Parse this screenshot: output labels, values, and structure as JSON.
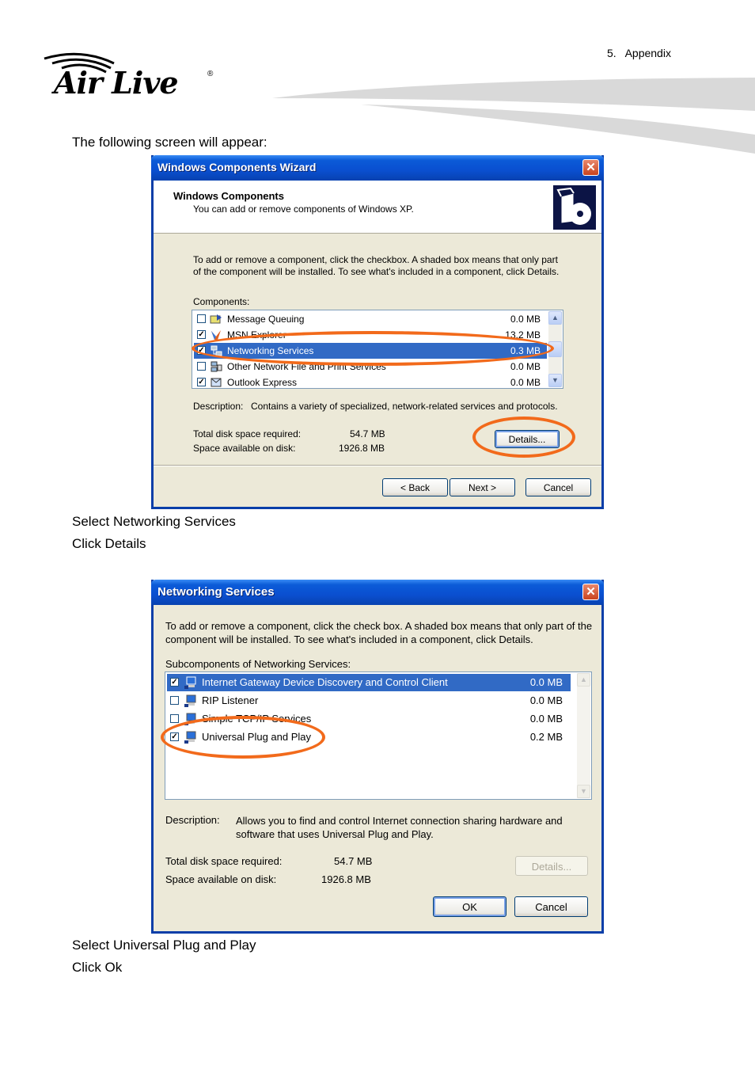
{
  "header": {
    "logo_text": "Air Live",
    "logo_registered": "®",
    "section": "5.   Appendix"
  },
  "instructions": {
    "intro": "The following screen will appear:",
    "step1_a": "Select Networking Services",
    "step1_b": "Click Details",
    "step2_a": "Select Universal Plug and Play",
    "step2_b": "Click Ok"
  },
  "wizard": {
    "title": "Windows Components Wizard",
    "close": "✕",
    "heading": "Windows Components",
    "subheading": "You can add or remove components of Windows XP.",
    "instruction": "To add or remove a component, click the checkbox.  A shaded box means that only part of the component will be installed.  To see what's included in a component, click Details.",
    "components_label": "Components:",
    "components": [
      {
        "name": "Message Queuing",
        "size": "0.0 MB",
        "checked": false,
        "selected": false,
        "icon": "message-queue-icon"
      },
      {
        "name": "MSN Explorer",
        "size": "13.2 MB",
        "checked": true,
        "selected": false,
        "icon": "msn-butterfly-icon"
      },
      {
        "name": "Networking Services",
        "size": "0.3 MB",
        "checked": true,
        "selected": true,
        "icon": "network-icon"
      },
      {
        "name": "Other Network File and Print Services",
        "size": "0.0 MB",
        "checked": false,
        "selected": false,
        "icon": "network-printer-icon"
      },
      {
        "name": "Outlook Express",
        "size": "0.0 MB",
        "checked": true,
        "selected": false,
        "icon": "outlook-icon"
      }
    ],
    "description_label": "Description:",
    "description": "Contains a variety of specialized, network-related services and protocols.",
    "total_label": "Total disk space required:",
    "total_value": "54.7 MB",
    "avail_label": "Space available on disk:",
    "avail_value": "1926.8 MB",
    "details_button": "Details...",
    "back_button": "< Back",
    "next_button": "Next >",
    "cancel_button": "Cancel"
  },
  "netsvc": {
    "title": "Networking Services",
    "close": "✕",
    "instruction": "To add or remove a component, click the check box. A shaded box means that only part of the component will be installed. To see what's included in a component, click Details.",
    "subcomponents_label": "Subcomponents of Networking Services:",
    "items": [
      {
        "name": "Internet Gateway Device Discovery and Control Client",
        "size": "0.0 MB",
        "checked": true,
        "selected": true
      },
      {
        "name": "RIP Listener",
        "size": "0.0 MB",
        "checked": false,
        "selected": false
      },
      {
        "name": "Simple TCP/IP Services",
        "size": "0.0 MB",
        "checked": false,
        "selected": false
      },
      {
        "name": "Universal Plug and Play",
        "size": "0.2 MB",
        "checked": true,
        "selected": false
      }
    ],
    "description_label": "Description:",
    "description": "Allows you to find and control Internet connection sharing hardware and software that uses Universal Plug and Play.",
    "total_label": "Total disk space required:",
    "total_value": "54.7 MB",
    "avail_label": "Space available on disk:",
    "avail_value": "1926.8 MB",
    "details_button": "Details...",
    "ok_button": "OK",
    "cancel_button": "Cancel"
  },
  "colors": {
    "highlight_oval": "#f26a1b",
    "selection": "#316ac5",
    "titlebar": "#0a4fd0"
  }
}
